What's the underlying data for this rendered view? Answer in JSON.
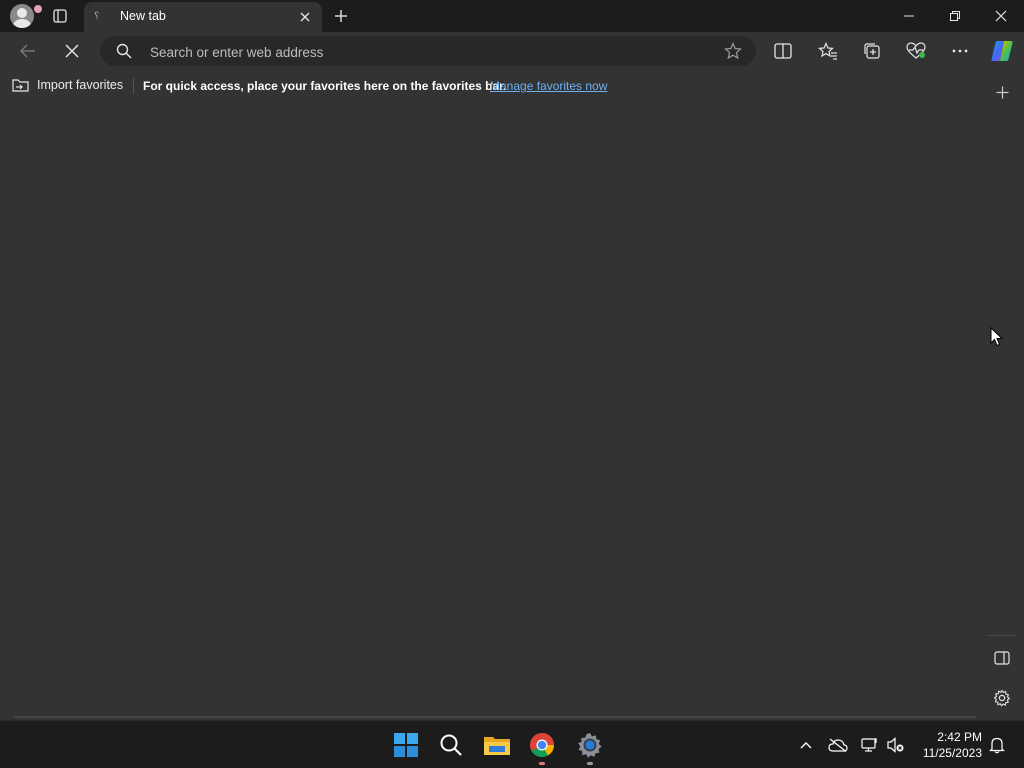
{
  "browser": {
    "tab": {
      "title": "New tab"
    },
    "address_bar": {
      "placeholder": "Search or enter web address",
      "value": ""
    },
    "favorites_bar": {
      "import_label": "Import favorites",
      "message": "For quick access, place your favorites here on the favorites bar.",
      "manage_link": "Manage favorites now"
    }
  },
  "taskbar": {
    "clock": {
      "time": "2:42 PM",
      "date": "11/25/2023"
    }
  },
  "colors": {
    "accent_link": "#6fb1f5",
    "window_bg": "#333333",
    "titlebar_bg": "#1c1c1c"
  }
}
